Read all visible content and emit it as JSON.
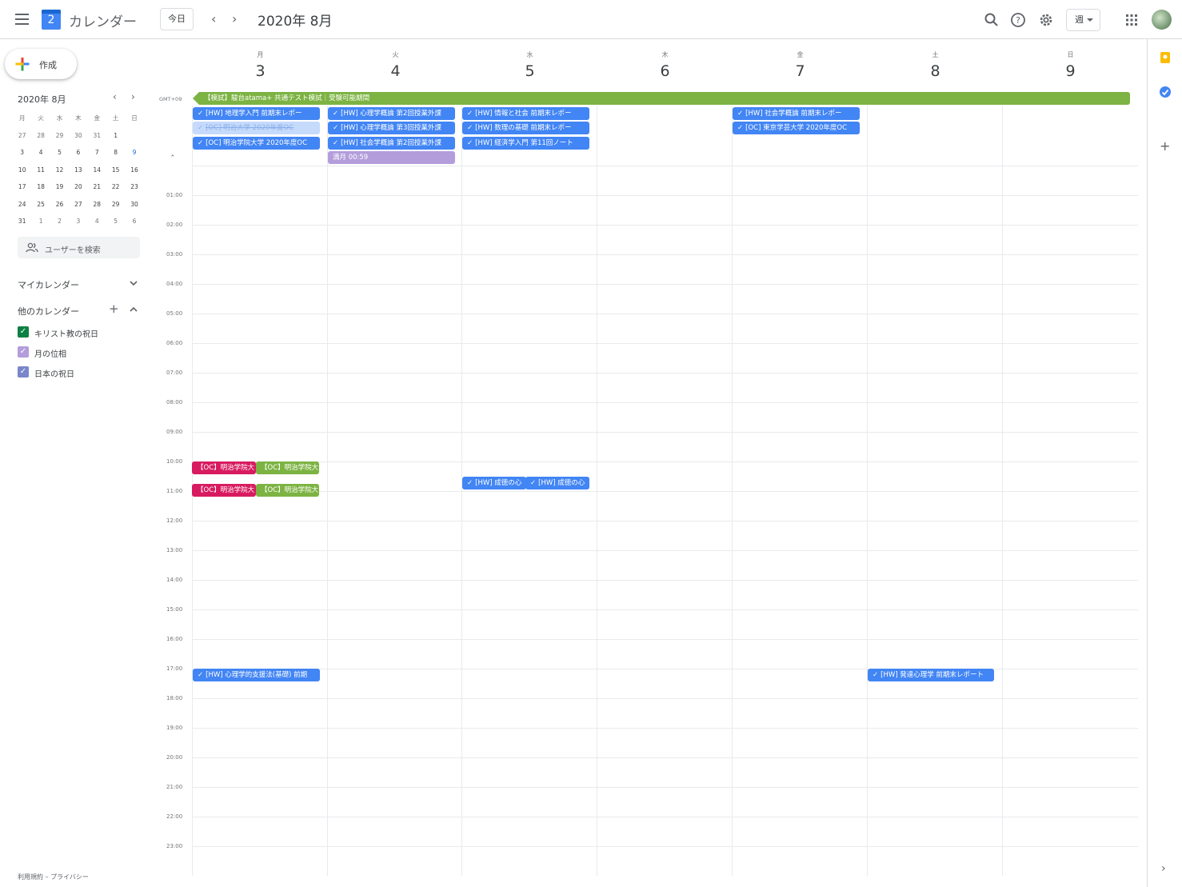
{
  "header": {
    "app_title": "カレンダー",
    "logo_day": "2",
    "today_label": "今日",
    "current_period": "2020年 8月",
    "view_label": "週"
  },
  "sidebar": {
    "create_label": "作成",
    "mini_title": "2020年 8月",
    "mini_weekdays": [
      "月",
      "火",
      "水",
      "木",
      "金",
      "土",
      "日"
    ],
    "mini_weeks": [
      [
        "27",
        "28",
        "29",
        "30",
        "31",
        "1",
        "2"
      ],
      [
        "3",
        "4",
        "5",
        "6",
        "7",
        "8",
        "9"
      ],
      [
        "10",
        "11",
        "12",
        "13",
        "14",
        "15",
        "16"
      ],
      [
        "17",
        "18",
        "19",
        "20",
        "21",
        "22",
        "23"
      ],
      [
        "24",
        "25",
        "26",
        "27",
        "28",
        "29",
        "30"
      ],
      [
        "31",
        "1",
        "2",
        "3",
        "4",
        "5",
        "6"
      ]
    ],
    "search_users": "ユーザーを検索",
    "my_calendars": "マイカレンダー",
    "other_calendars": "他のカレンダー",
    "calendars": [
      {
        "label": "キリスト教の祝日",
        "color": "#0b8043"
      },
      {
        "label": "月の位相",
        "color": "#b39ddb"
      },
      {
        "label": "日本の祝日",
        "color": "#7986cb"
      }
    ],
    "footer": "利用規約 – プライバシー"
  },
  "week": {
    "timezone": "GMT+09",
    "days": [
      {
        "dow": "月",
        "num": "3"
      },
      {
        "dow": "火",
        "num": "4"
      },
      {
        "dow": "水",
        "num": "5"
      },
      {
        "dow": "木",
        "num": "6"
      },
      {
        "dow": "金",
        "num": "7"
      },
      {
        "dow": "土",
        "num": "8"
      },
      {
        "dow": "日",
        "num": "9"
      }
    ],
    "hours": [
      "01:00",
      "02:00",
      "03:00",
      "04:00",
      "05:00",
      "06:00",
      "07:00",
      "08:00",
      "09:00",
      "10:00",
      "11:00",
      "12:00",
      "13:00",
      "14:00",
      "15:00",
      "16:00",
      "17:00",
      "18:00",
      "19:00",
      "20:00",
      "21:00",
      "22:00",
      "23:00"
    ],
    "allday_banner": "【模試】駿台atama+ 共通テスト模試｜受験可能期間",
    "allday_events": {
      "mon": [
        {
          "text": "[HW] 地理学入門 前期末レポー",
          "style": "blue",
          "check": true
        },
        {
          "text": "[OC] 明治大学 2020年度OC",
          "style": "light",
          "check": true
        },
        {
          "text": "[OC] 明治学院大学 2020年度OC",
          "style": "blue",
          "check": true
        }
      ],
      "tue": [
        {
          "text": "[HW] 心理学概論 第2回授業外課",
          "style": "blue",
          "check": true
        },
        {
          "text": "[HW] 心理学概論 第3回授業外課",
          "style": "blue",
          "check": true
        },
        {
          "text": "[HW] 社会学概論 第2回授業外課",
          "style": "blue",
          "check": true
        },
        {
          "text": "満月 00:59",
          "style": "purple",
          "check": false
        }
      ],
      "wed": [
        {
          "text": "[HW] 情報と社会 前期末レポー",
          "style": "blue",
          "check": true
        },
        {
          "text": "[HW] 数理の基礎 前期末レポー",
          "style": "blue",
          "check": true
        },
        {
          "text": "[HW] 経済学入門 第11回ノート",
          "style": "blue",
          "check": true
        }
      ],
      "fri": [
        {
          "text": "[HW] 社会学概論 前期末レポー",
          "style": "blue",
          "check": true
        },
        {
          "text": "[OC] 東京学芸大学 2020年度OC",
          "style": "blue",
          "check": true
        }
      ]
    },
    "timed_events": {
      "mon_1000_a": "【OC】明治学院大",
      "mon_1000_b": "【OC】明治学院大",
      "mon_1100_a": "【OC】明治学院大",
      "mon_1100_b": "【OC】明治学院大",
      "wed_1030_a": "[HW] 成徳の心",
      "wed_1030_b": "[HW] 成徳の心",
      "mon_1700": "[HW] 心理学的支援法(基礎) 前期",
      "sat_1700": "[HW] 発達心理学 前期末レポート"
    }
  }
}
